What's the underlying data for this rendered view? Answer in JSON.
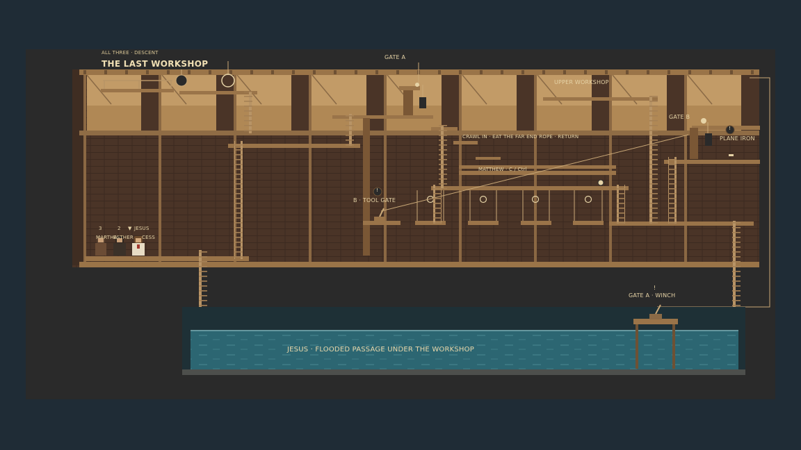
{
  "level": {
    "subtitle": "ALL THREE · DESCENT",
    "title": "THE LAST WORKSHOP"
  },
  "markers": {
    "gate_a": "GATE A",
    "upper_workshop": "UPPER WORKSHOP",
    "gate_b": "GATE B",
    "plane_iron": "PLANE IRON",
    "crawl_hint": "CRAWL IN · EAT THE FAR END ROPE · RETURN",
    "matthew_hint": "MATTHEW · C / Ctrl",
    "tool_gate": "B · TOOL GATE",
    "winch": "GATE A · WINCH",
    "winch_alert": "!",
    "pickup_alert": "!",
    "toolgate_alert": "!"
  },
  "characters": [
    {
      "num": "3",
      "name": "MARTHA"
    },
    {
      "num": "2",
      "name": "ESTHER"
    },
    {
      "num": "▼",
      "name": "JESUS",
      "active": true,
      "status": "CESS"
    }
  ],
  "water": {
    "label": "JESUS · FLOODED PASSAGE UNDER THE WORKSHOP"
  },
  "colors": {
    "background": "#1f2c36",
    "frame": "#2a2a2a",
    "wall": "#4b3628",
    "sky_band": "#c19a66",
    "beam": "#8d6a45",
    "water": "#2b6571",
    "text": "#e6d3a6"
  }
}
